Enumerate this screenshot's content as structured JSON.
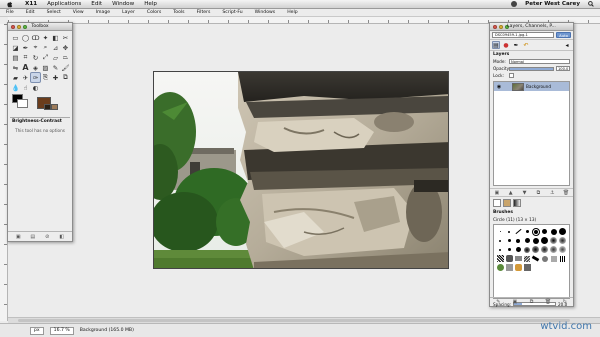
{
  "menubar": {
    "app_name": "X11",
    "items": [
      "Applications",
      "Edit",
      "Window",
      "Help"
    ],
    "user": "Peter West Carey"
  },
  "image_window": {
    "menu": [
      "File",
      "Edit",
      "Select",
      "View",
      "Image",
      "Layer",
      "Colors",
      "Tools",
      "Filters",
      "Script-Fu",
      "Windows",
      "Help"
    ],
    "status": {
      "unit": "px",
      "zoom": "16.7 %",
      "layer_info": "Background (165.0 MB)"
    }
  },
  "toolbox": {
    "title": "Toolbox",
    "selected_tool_index": 26,
    "tool_options_title": "Brightness-Contrast",
    "tool_options_body": "This tool has no options"
  },
  "layers_dock": {
    "title": "Layers, Channels, P...",
    "image_combo": "DSC09459-1.jpg-1",
    "auto_button": "Auto",
    "section_title": "Layers",
    "mode_label": "Mode:",
    "mode_value": "Normal",
    "opacity_label": "Opacity:",
    "opacity_value": "100.0",
    "opacity_percent": 100,
    "lock_label": "Lock:",
    "layer_name": "Background",
    "brushes_title": "Brushes",
    "brush_name": "Circle (11) (13 × 13)",
    "spacing_label": "Spacing:",
    "spacing_value": "20.0"
  },
  "watermark": "wtvid.com",
  "icons": {
    "apple": "apple-icon",
    "eye": "eye-icon",
    "chain": "chain-icon"
  },
  "colors": {
    "foreground": "#000000",
    "background": "#ffffff",
    "layer_selected": "#a9bbd8",
    "accent": "#6f96cf"
  }
}
